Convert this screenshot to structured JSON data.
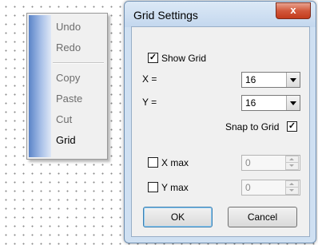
{
  "context_menu": {
    "items": [
      {
        "label": "Undo"
      },
      {
        "label": "Redo"
      },
      {
        "label": "Copy"
      },
      {
        "label": "Paste"
      },
      {
        "label": "Cut"
      },
      {
        "label": "Grid"
      }
    ]
  },
  "dialog": {
    "title": "Grid Settings",
    "close_glyph": "x",
    "show_grid": {
      "label": "Show Grid",
      "checked": true
    },
    "x": {
      "label": "X =",
      "value": "16"
    },
    "y": {
      "label": "Y =",
      "value": "16"
    },
    "snap_to_grid": {
      "label": "Snap to Grid",
      "checked": true
    },
    "x_max": {
      "label": "X max",
      "checked": false,
      "value": "0"
    },
    "y_max": {
      "label": "Y max",
      "checked": false,
      "value": "0"
    },
    "ok_label": "OK",
    "cancel_label": "Cancel",
    "check_glyph": "✓"
  }
}
